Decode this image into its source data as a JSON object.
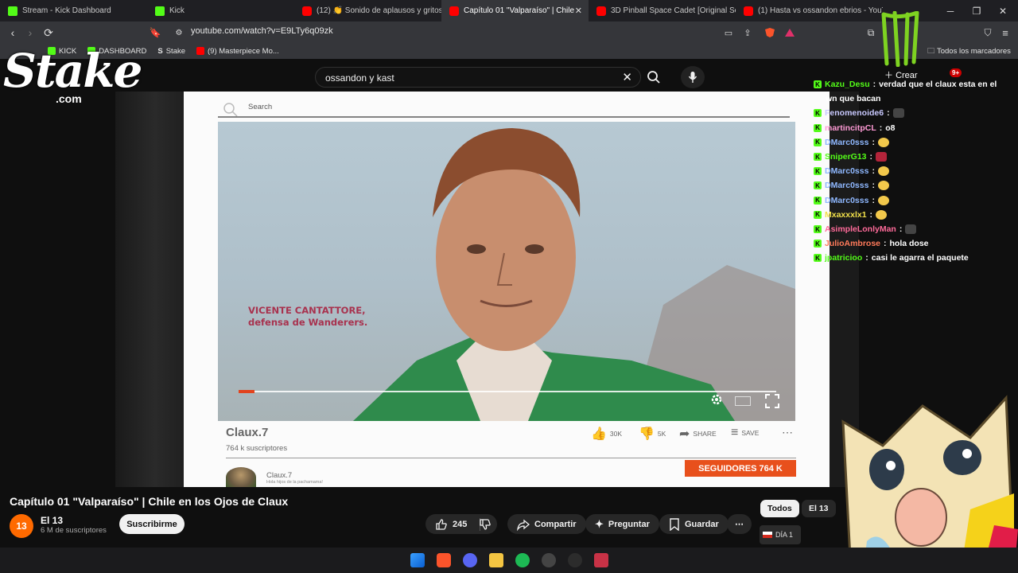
{
  "browser": {
    "tabs": [
      {
        "label": "Stream - Kick Dashboard",
        "icon": "kick-icon"
      },
      {
        "label": "Kick",
        "icon": "kick-icon"
      },
      {
        "label": "(12) 👏 Sonido de aplausos y gritos",
        "icon": "youtube-icon"
      },
      {
        "label": "Capítulo 01 \"Valparaíso\" | Chile",
        "icon": "youtube-icon",
        "active": true
      },
      {
        "label": "3D Pinball Space Cadet [Original Sou",
        "icon": "youtube-icon"
      },
      {
        "label": "(1) Hasta vs ossandon ebrios - YouTu",
        "icon": "youtube-icon"
      }
    ],
    "url": "youtube.com/watch?v=E9LTy6q09zk",
    "bookmarks": [
      "KICK",
      "DASHBOARD",
      "Stake",
      "(9) Masterpiece Mo..."
    ],
    "all_bookmarks": "Todos los marcadores"
  },
  "youtube": {
    "search_value": "ossandon y kast",
    "create_label": "Crear",
    "notifications": "9+",
    "video": {
      "inner_search": "Search",
      "caption_line1": "VICENTE CANTATTORE,",
      "caption_line2": "defensa de Wanderers.",
      "progress": 0.03,
      "channel": "Claux.7",
      "subs": "764 k suscriptores",
      "likes": "30K",
      "dislikes": "5K",
      "share": "SHARE",
      "save": "SAVE",
      "channel2": "Claux.7",
      "channel2_sub": "Hola hijos de la pachamama!",
      "followers_banner": "SEGUIDORES 764 K"
    },
    "title": "Capítulo 01 \"Valparaíso\" | Chile en los Ojos de Claux",
    "channel_avatar": "13",
    "channel_name": "El 13",
    "channel_subs": "6 M de suscriptores",
    "subscribe": "Suscribirme",
    "likes": "245",
    "share": "Compartir",
    "ask": "Preguntar",
    "save": "Guardar",
    "chips": [
      "Todos",
      "El 13"
    ]
  },
  "overlay": {
    "stake_logo": "Stake",
    "stake_sub": ".com",
    "day_badge": "DÍA 1"
  },
  "chat": [
    {
      "user": "Kazu_Desu",
      "color": "#53fc18",
      "text": "verdad que el claux esta en el"
    },
    {
      "user": "",
      "color": "#ffffff",
      "text": "wn que bacan"
    },
    {
      "user": "Fenomenoide6",
      "color": "#c9c9ff",
      "text": "",
      "emote": "dark"
    },
    {
      "user": "martincitpCL",
      "color": "#ff9ad5",
      "text": "o8"
    },
    {
      "user": "DMarc0sss",
      "color": "#8fb8ff",
      "text": "",
      "emote": "yellow"
    },
    {
      "user": "SniperG13",
      "color": "#53fc18",
      "text": "",
      "emote": "red"
    },
    {
      "user": "DMarc0sss",
      "color": "#8fb8ff",
      "text": "",
      "emote": "yellow"
    },
    {
      "user": "DMarc0sss",
      "color": "#8fb8ff",
      "text": "",
      "emote": "yellow"
    },
    {
      "user": "DMarc0sss",
      "color": "#8fb8ff",
      "text": "",
      "emote": "yellow"
    },
    {
      "user": "Mxaxxxlx1",
      "color": "#f1e04a",
      "text": "",
      "emote": "yellow"
    },
    {
      "user": "AsimpleLonlyMan",
      "color": "#ff6b9a",
      "text": "",
      "emote": "dark"
    },
    {
      "user": "JulioAmbrose",
      "color": "#ff7a5a",
      "text": "hola dose"
    },
    {
      "user": "jpatricioo",
      "color": "#53fc18",
      "text": "casi le agarra el paquete"
    }
  ]
}
